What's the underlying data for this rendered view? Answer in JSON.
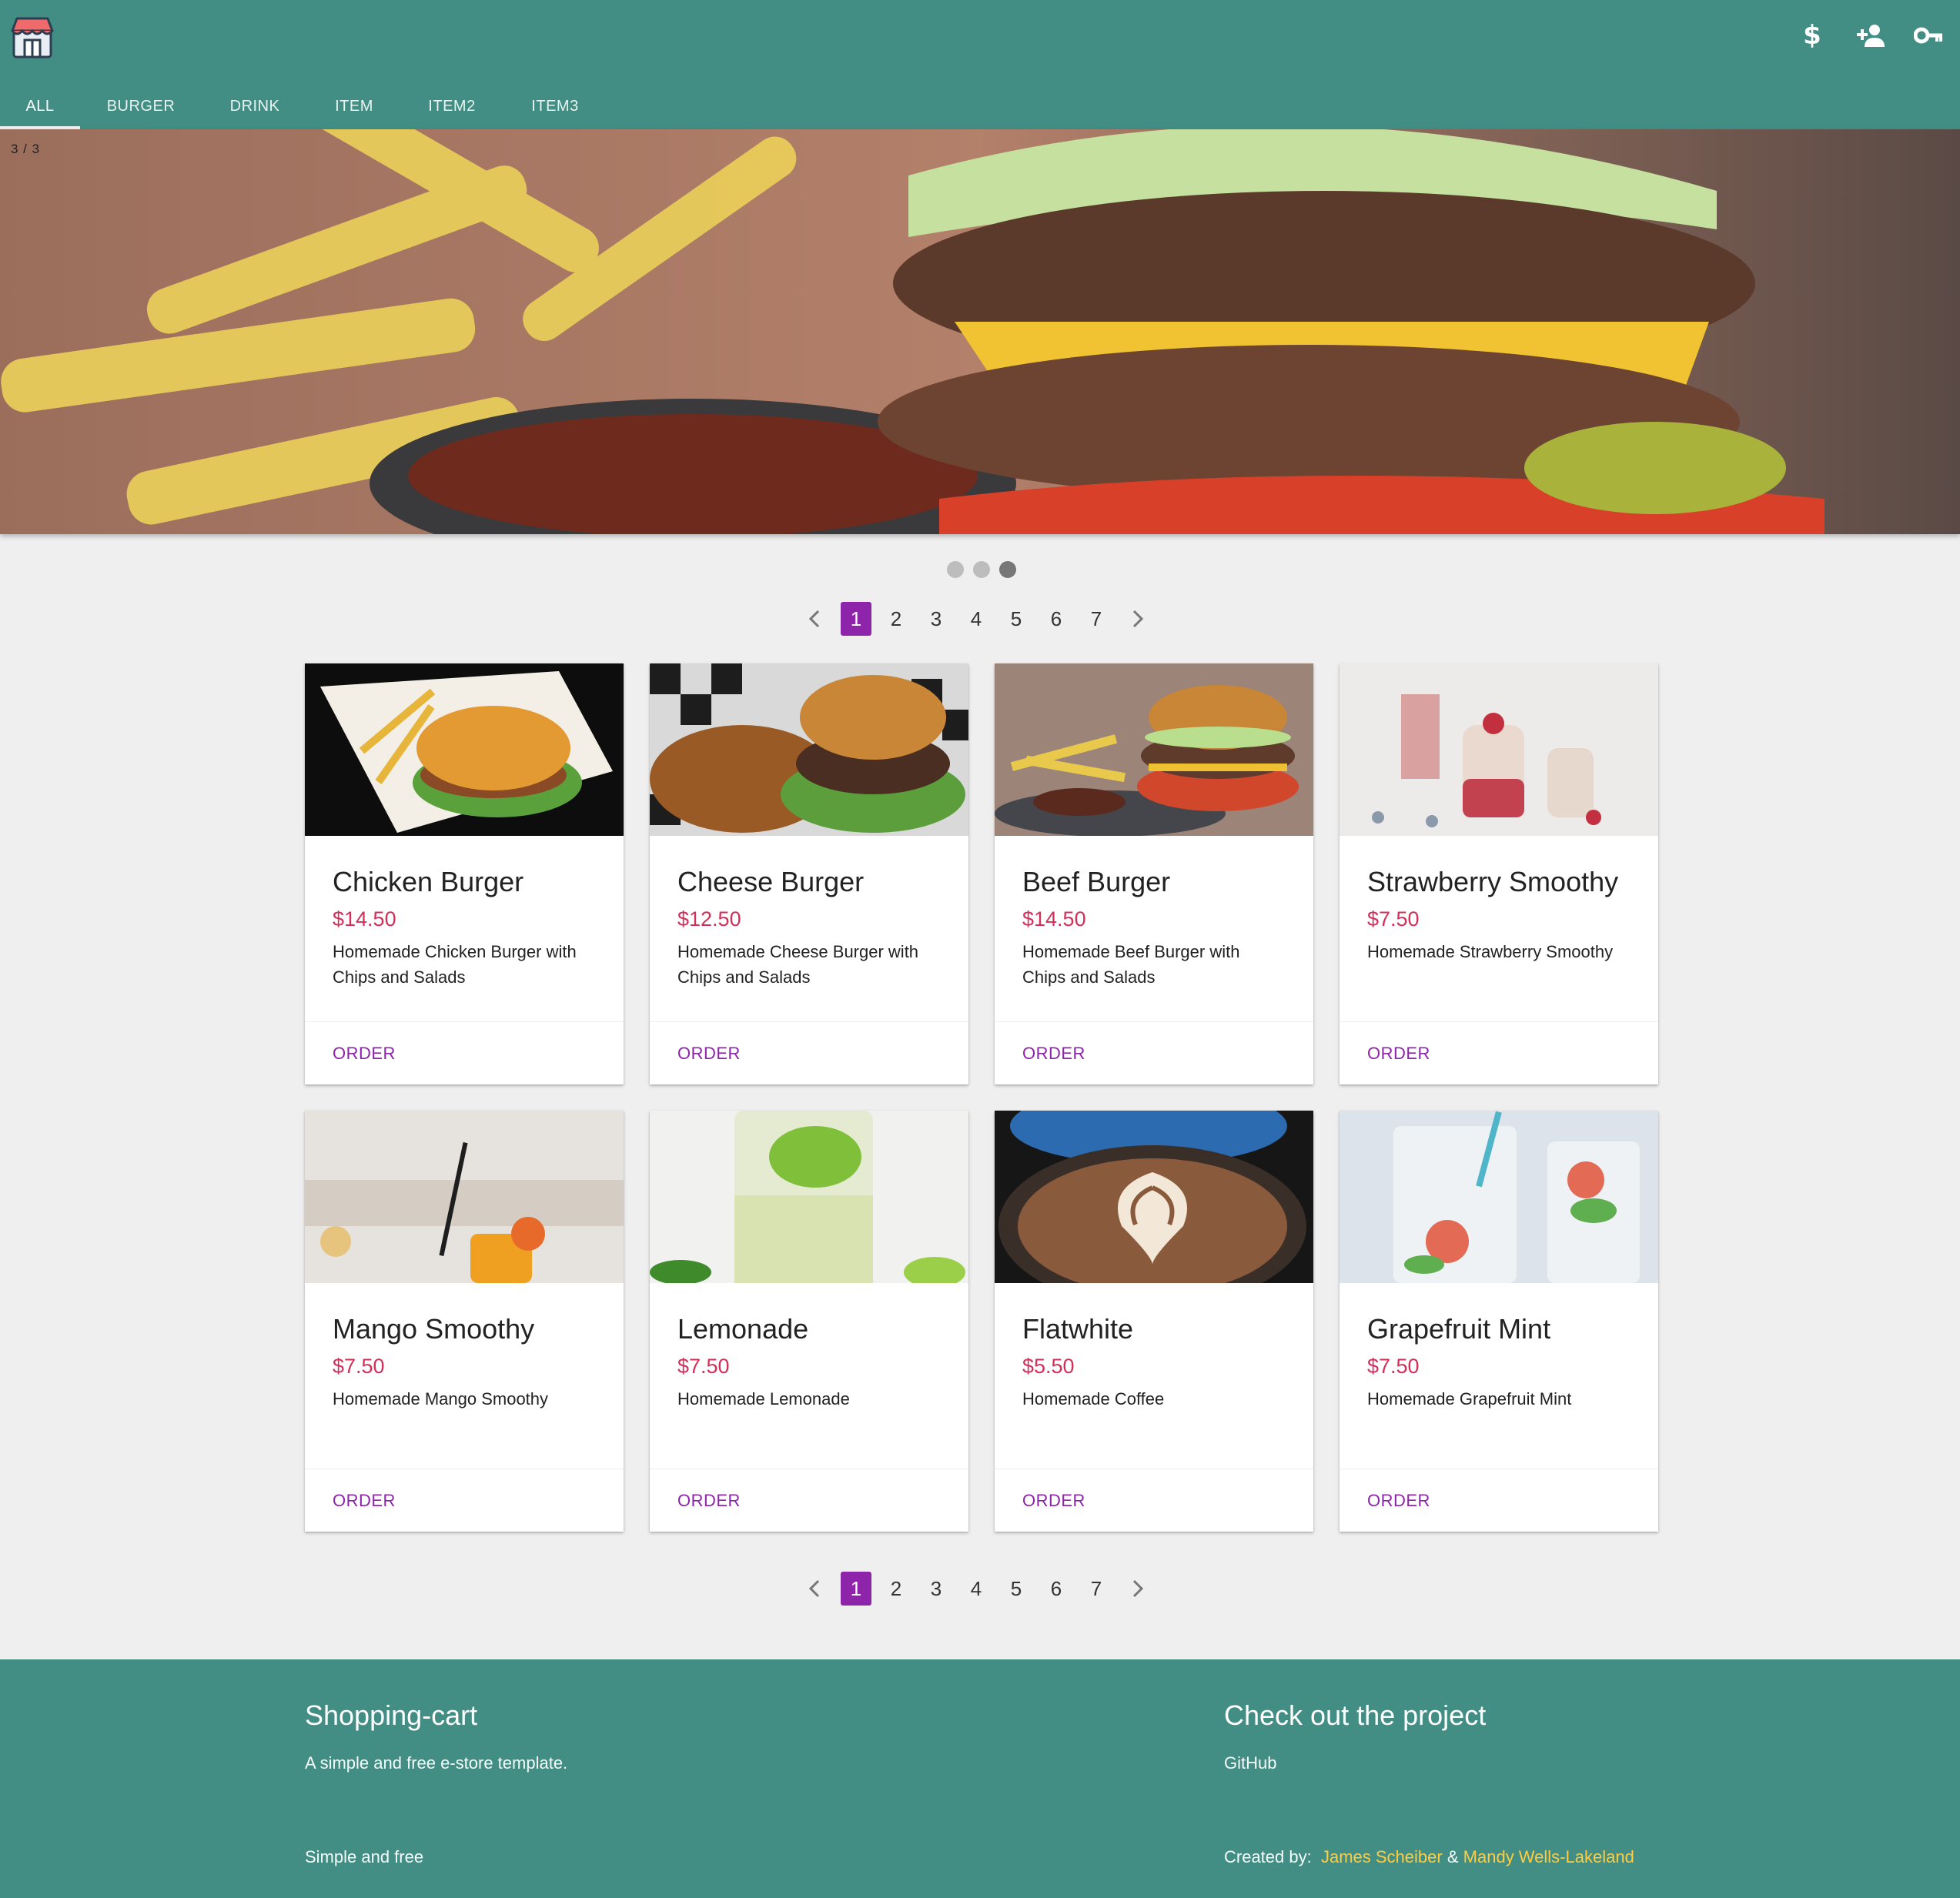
{
  "header": {
    "tabs": [
      "ALL",
      "BURGER",
      "DRINK",
      "ITEM",
      "ITEM2",
      "ITEM3"
    ],
    "active_tab": "ALL",
    "actions": [
      "dollar-icon",
      "add-user-icon",
      "key-icon"
    ],
    "dollar_glyph": "$"
  },
  "hero": {
    "counter": "3 / 3",
    "slides": 3,
    "active_slide": 3
  },
  "pagination": {
    "pages": [
      "1",
      "2",
      "3",
      "4",
      "5",
      "6",
      "7"
    ],
    "current": "1"
  },
  "products": [
    {
      "title": "Chicken Burger",
      "price": "$14.50",
      "description": "Homemade Chicken Burger with Chips and Salads",
      "action": "ORDER"
    },
    {
      "title": "Cheese Burger",
      "price": "$12.50",
      "description": "Homemade Cheese Burger with Chips and Salads",
      "action": "ORDER"
    },
    {
      "title": "Beef Burger",
      "price": "$14.50",
      "description": "Homemade Beef Burger with Chips and Salads",
      "action": "ORDER"
    },
    {
      "title": "Strawberry Smoothy",
      "price": "$7.50",
      "description": "Homemade Strawberry Smoothy",
      "action": "ORDER"
    },
    {
      "title": "Mango Smoothy",
      "price": "$7.50",
      "description": "Homemade Mango Smoothy",
      "action": "ORDER"
    },
    {
      "title": "Lemonade",
      "price": "$7.50",
      "description": "Homemade Lemonade",
      "action": "ORDER"
    },
    {
      "title": "Flatwhite",
      "price": "$5.50",
      "description": "Homemade Coffee",
      "action": "ORDER"
    },
    {
      "title": "Grapefruit Mint",
      "price": "$7.50",
      "description": "Homemade Grapefruit Mint",
      "action": "ORDER"
    }
  ],
  "footer": {
    "title": "Shopping-cart",
    "tagline": "A simple and free e-store template.",
    "bottom_left": "Simple and free",
    "project_title": "Check out the project",
    "project_link": "GitHub",
    "created_by_label": "Created by:",
    "author1": "James Scheiber",
    "and": "&",
    "author2": "Mandy Wells-Lakeland"
  },
  "colors": {
    "primary": "#428e84",
    "accent": "#8e24aa",
    "price": "#d32f5a",
    "link": "#ffcc40",
    "background": "#efefef"
  }
}
